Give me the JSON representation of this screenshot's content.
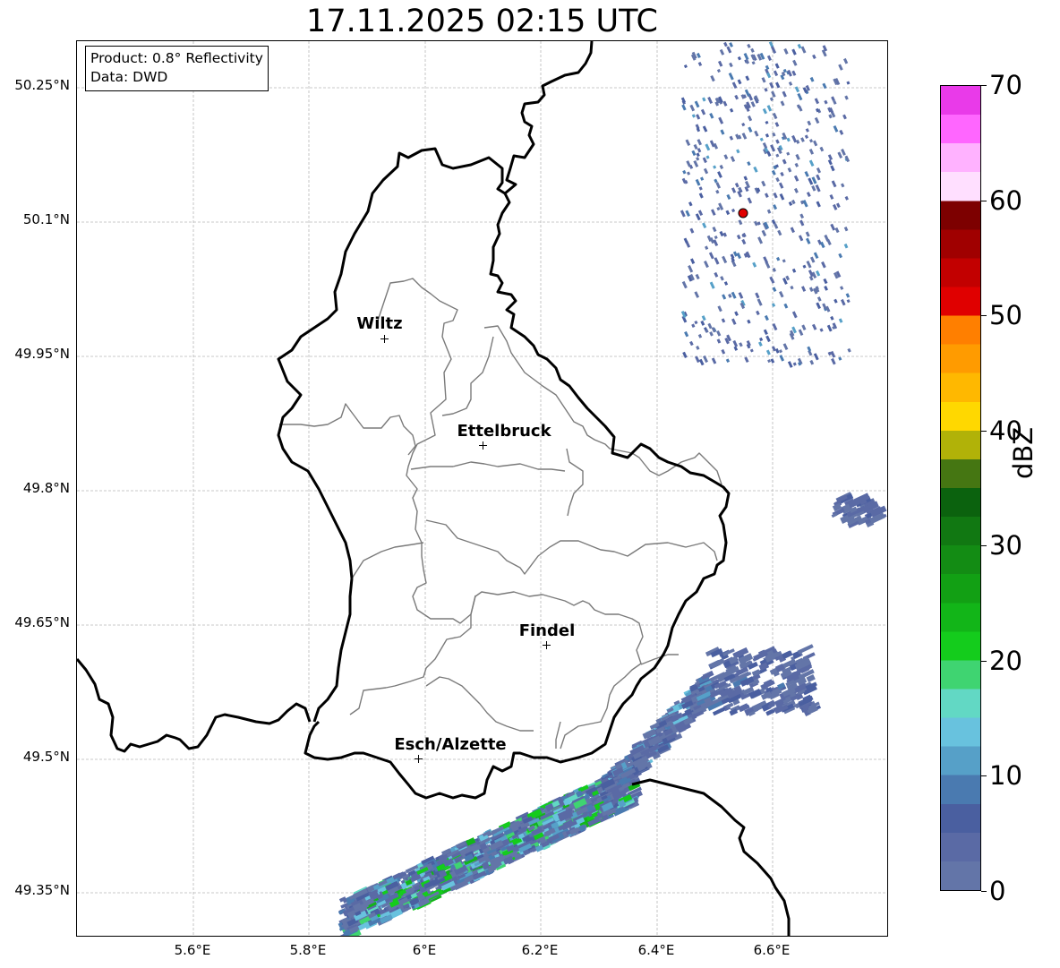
{
  "title": "17.11.2025 02:15 UTC",
  "info_box": {
    "line1": "Product: 0.8° Reflectivity",
    "line2": "Data: DWD"
  },
  "chart_data": {
    "type": "heatmap",
    "title": "17.11.2025 02:15 UTC",
    "map_extent": {
      "lon": [
        5.4,
        6.8
      ],
      "lat": [
        49.3,
        50.3
      ]
    },
    "grid": true,
    "latitude_ticks": [
      "50.25°N",
      "50.1°N",
      "49.95°N",
      "49.8°N",
      "49.65°N",
      "49.5°N",
      "49.35°N"
    ],
    "longitude_ticks": [
      "5.6°E",
      "5.8°E",
      "6°E",
      "6.2°E",
      "6.4°E",
      "6.6°E"
    ],
    "cities": [
      {
        "name": "Wiltz",
        "lon": 5.93,
        "lat": 49.97
      },
      {
        "name": "Ettelbruck",
        "lon": 6.1,
        "lat": 49.85
      },
      {
        "name": "Findel",
        "lon": 6.21,
        "lat": 49.63
      },
      {
        "name": "Esch/Alzette",
        "lon": 5.99,
        "lat": 49.5
      }
    ],
    "radar_site": {
      "lon": 6.55,
      "lat": 50.11
    },
    "colorbar": {
      "label": "dBZ",
      "min": 0,
      "max": 70,
      "step": 2.5,
      "tick_labels": [
        "0",
        "10",
        "20",
        "30",
        "40",
        "50",
        "60",
        "70"
      ],
      "colors": [
        "#6375a8",
        "#5a6aa5",
        "#4a5fa0",
        "#4a7ab0",
        "#56a0c8",
        "#68c2de",
        "#62d8c4",
        "#3fd471",
        "#14cc1c",
        "#12b518",
        "#12a014",
        "#138c14",
        "#117812",
        "#0b620e",
        "#457612",
        "#b1b208",
        "#ffd800",
        "#ffb800",
        "#ff9b00",
        "#ff7f00",
        "#e00000",
        "#c20000",
        "#a00000",
        "#7d0000",
        "#ffdfff",
        "#ffb2ff",
        "#ff66ff",
        "#e93ae9"
      ]
    },
    "echo_regions": [
      {
        "area": "southwest band near Esch/Alzette and toward Thionville",
        "lon": [
          5.85,
          6.35
        ],
        "lat": [
          49.32,
          49.47
        ],
        "dbz_range": [
          2,
          25
        ]
      },
      {
        "area": "southeast near Remich / Moselle",
        "lon": [
          6.3,
          6.48
        ],
        "lat": [
          49.46,
          49.58
        ],
        "dbz_range": [
          2,
          15
        ]
      },
      {
        "area": "east of Moselle",
        "lon": [
          6.48,
          6.66
        ],
        "lat": [
          49.55,
          49.62
        ],
        "dbz_range": [
          2,
          8
        ]
      },
      {
        "area": "Eifel isolated cells",
        "lon": [
          6.44,
          6.73
        ],
        "lat": [
          49.94,
          50.3
        ],
        "dbz_range": [
          2,
          12
        ]
      },
      {
        "area": "Saar streak",
        "lon": [
          6.7,
          6.77
        ],
        "lat": [
          49.76,
          49.79
        ],
        "dbz_range": [
          2,
          6
        ]
      }
    ]
  }
}
